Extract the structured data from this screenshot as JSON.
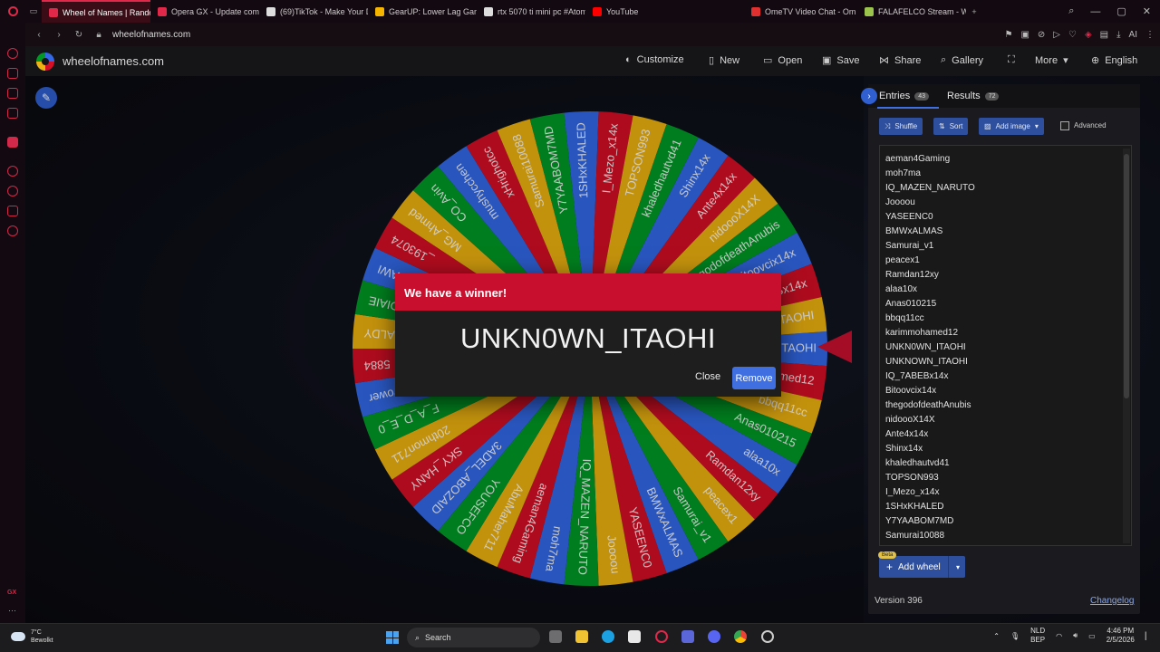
{
  "browser": {
    "tabs": [
      {
        "label": "Wheel of Names | Random",
        "active": true,
        "color": "#e0284a"
      },
      {
        "label": "Opera GX - Update compl",
        "active": false,
        "color": "#e0284a"
      },
      {
        "label": "(69)TikTok - Make Your D",
        "active": false,
        "color": "#dddddd"
      },
      {
        "label": "GearUP: Lower Lag Game",
        "active": false,
        "color": "#f5b400"
      },
      {
        "label": "rtx 5070 ti mini pc #Atomh",
        "active": false,
        "color": "#dddddd"
      },
      {
        "label": "YouTube",
        "active": false,
        "color": "#ff0000"
      },
      {
        "label": "OmeTV Video Chat - Om",
        "active": false,
        "color": "#e03030"
      },
      {
        "label": "FALAFELCO Stream - Wat",
        "active": false,
        "color": "#9ac44c"
      }
    ],
    "url": "wheelofnames.com",
    "ai_label": "AI"
  },
  "site": {
    "name": "wheelofnames.com",
    "menu": [
      {
        "label": "Customize",
        "icon": "palette-icon"
      },
      {
        "label": "New",
        "icon": "new-file-icon"
      },
      {
        "label": "Open",
        "icon": "folder-icon"
      },
      {
        "label": "Save",
        "icon": "save-icon"
      },
      {
        "label": "Share",
        "icon": "share-icon"
      },
      {
        "label": "Gallery",
        "icon": "search-icon"
      },
      {
        "label": "",
        "icon": "fullscreen-icon"
      },
      {
        "label": "More",
        "icon": "chevron-down-icon"
      },
      {
        "label": "English",
        "icon": "globe-icon"
      }
    ]
  },
  "wheel": {
    "colors": [
      "#3369e8",
      "#d50f25",
      "#eeb211",
      "#009925"
    ],
    "segments": [
      "UNKN0WN_ITAOHI",
      "karimmohamed12",
      "bbqq11cc",
      "Anas010215",
      "alaa10x",
      "Ramdan12xy",
      "peacex1",
      "Samurai_v1",
      "BMWxALMAS",
      "YASEENC0",
      "Joooou",
      "IQ_MAZEN_NARUTO",
      "moh7ma",
      "aeman4Gaming",
      "AbuMaher711",
      "YOUSEFCO",
      "3ADEL_ABOZAID",
      "SKY_HANY",
      "20thmon711",
      "F_A_D_E_0",
      "ruolPower",
      "5884",
      "BALDY",
      "DIAIE",
      "AWI",
      "_193074",
      "MG_Ahmed",
      "CO_Avin",
      "mushycchen",
      "xHrighotcc",
      "Samurai10088",
      "Y7YAABOM7MD",
      "1SHxKHALED",
      "I_Mezo_x14x",
      "TOPSON993",
      "khaledhautvd41",
      "Shinx14x",
      "Ante4x14x",
      "nidoooX14X",
      "thegodofdeathAnubis",
      "Bitoovcix14x",
      "IQ_7ABEBx14x",
      "UNKN0WN_ITAOHI"
    ],
    "pointer_color": "#c8102e"
  },
  "dialog": {
    "title": "We have a winner!",
    "winner": "UNKN0WN_ITAOHI",
    "close_label": "Close",
    "remove_label": "Remove"
  },
  "panel": {
    "entries_tab": "Entries",
    "entries_count": "43",
    "results_tab": "Results",
    "results_count": "72",
    "shuffle_label": "Shuffle",
    "sort_label": "Sort",
    "add_image_label": "Add image",
    "advanced_label": "Advanced",
    "entries": [
      "aeman4Gaming",
      "moh7ma",
      "IQ_MAZEN_NARUTO",
      "Joooou",
      "YASEENC0",
      "BMWxALMAS",
      "Samurai_v1",
      "peacex1",
      "Ramdan12xy",
      "alaa10x",
      "Anas010215",
      "bbqq11cc",
      "karimmohamed12",
      "UNKN0WN_ITAOHI",
      "UNKNOWN_ITAOHI",
      "IQ_7ABEBx14x",
      "Bitoovcix14x",
      "thegodofdeathAnubis",
      "nidoooX14X",
      "Ante4x14x",
      "Shinx14x",
      "khaledhautvd41",
      "TOPSON993",
      "I_Mezo_x14x",
      "1SHxKHALED",
      "Y7YAABOM7MD",
      "Samurai10088"
    ],
    "beta_label": "Beta",
    "add_wheel_label": "Add wheel",
    "version": "Version 396",
    "changelog": "Changelog"
  },
  "taskbar": {
    "temperature": "7°C",
    "weather": "Bewolkt",
    "search": "Search",
    "lang_top": "NLD",
    "lang_bottom": "BEP",
    "time": "4:46 PM",
    "date": "2/5/2026"
  }
}
